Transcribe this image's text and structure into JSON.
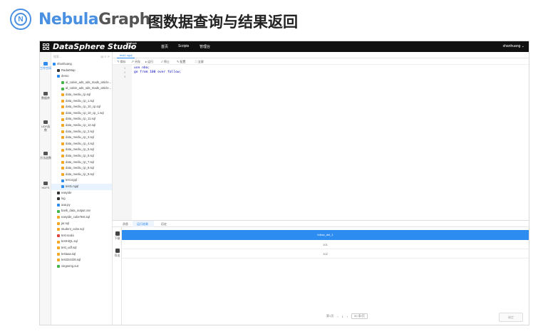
{
  "slide": {
    "brand_part1": "Nebula",
    "brand_part2": "Graph",
    "logo_letter": "N",
    "title": "图数据查询与结果返回"
  },
  "topbar": {
    "app_title": "DataSphere Studio",
    "version_line1": "WeBank",
    "version_line2": "v0.8.7",
    "nav": [
      "首页",
      "Scripts",
      "管理台"
    ],
    "user": "shanhuang"
  },
  "leftnav": [
    {
      "label": "工作空间",
      "icon": "folder-icon",
      "active": true
    },
    {
      "label": "数据库",
      "icon": "database-icon",
      "active": false
    },
    {
      "label": "UDF函数",
      "icon": "function-icon",
      "active": false
    },
    {
      "label": "方法函数",
      "icon": "method-icon",
      "active": false
    },
    {
      "label": "HDFS",
      "icon": "hdfs-icon",
      "active": false
    }
  ],
  "filetree": {
    "search_placeholder": "搜索...",
    "rows": [
      {
        "label": "shanhuang",
        "indent": 0,
        "icon": "folder-icon",
        "color": "#2d8cf0"
      },
      {
        "label": "RadarMap",
        "indent": 1,
        "icon": "folder-icon",
        "color": "#333"
      },
      {
        "label": "demo",
        "indent": 1,
        "icon": "folder-open-icon",
        "color": "#2d8cf0"
      },
      {
        "label": "al_calvin_ads_ods_mads_article...",
        "indent": 2,
        "icon": "file-icon",
        "color": "#44b549"
      },
      {
        "label": "al_calvin_ads_ods_mads_article...",
        "indent": 2,
        "icon": "file-icon",
        "color": "#44b549"
      },
      {
        "label": "data_mediu_cp.sql",
        "indent": 2,
        "icon": "sql-icon",
        "color": "#f5a623"
      },
      {
        "label": "data_mediu_cp_1.sql",
        "indent": 2,
        "icon": "sql-icon",
        "color": "#f5a623"
      },
      {
        "label": "data_mediu_cp_10_cp.sql",
        "indent": 2,
        "icon": "sql-icon",
        "color": "#f5a623"
      },
      {
        "label": "data_mediu_cp_10_cp_1.sql",
        "indent": 2,
        "icon": "sql-icon",
        "color": "#f5a623"
      },
      {
        "label": "data_mediu_cp_11.sql",
        "indent": 2,
        "icon": "sql-icon",
        "color": "#f5a623"
      },
      {
        "label": "data_mediu_cp_12.sql",
        "indent": 2,
        "icon": "sql-icon",
        "color": "#f5a623"
      },
      {
        "label": "data_mediu_cp_2.sql",
        "indent": 2,
        "icon": "sql-icon",
        "color": "#f5a623"
      },
      {
        "label": "data_mediu_cp_3.sql",
        "indent": 2,
        "icon": "sql-icon",
        "color": "#f5a623"
      },
      {
        "label": "data_mediu_cp_4.sql",
        "indent": 2,
        "icon": "sql-icon",
        "color": "#f5a623"
      },
      {
        "label": "data_mediu_cp_5.sql",
        "indent": 2,
        "icon": "sql-icon",
        "color": "#f5a623"
      },
      {
        "label": "data_mediu_cp_6.sql",
        "indent": 2,
        "icon": "sql-icon",
        "color": "#f5a623"
      },
      {
        "label": "data_mediu_cp_7.sql",
        "indent": 2,
        "icon": "sql-icon",
        "color": "#f5a623"
      },
      {
        "label": "data_mediu_cp_8.sql",
        "indent": 2,
        "icon": "sql-icon",
        "color": "#f5a623"
      },
      {
        "label": "data_mediu_cp_9.sql",
        "indent": 2,
        "icon": "sql-icon",
        "color": "#f5a623"
      },
      {
        "label": "test.ngql",
        "indent": 2,
        "icon": "ngql-icon",
        "color": "#2d8cf0"
      },
      {
        "label": "test1.ngql",
        "indent": 2,
        "icon": "ngql-icon",
        "color": "#2d8cf0",
        "selected": true
      },
      {
        "label": "easyide",
        "indent": 1,
        "icon": "folder-icon",
        "color": "#333"
      },
      {
        "label": "log",
        "indent": 1,
        "icon": "folder-icon",
        "color": "#333"
      },
      {
        "label": "aaa.py",
        "indent": 1,
        "icon": "python-icon",
        "color": "#2d8cf0"
      },
      {
        "label": "bank_data_output.csv",
        "indent": 1,
        "icon": "csv-icon",
        "color": "#44b549"
      },
      {
        "label": "easyide_cubeTest.sql",
        "indent": 1,
        "icon": "sql-icon",
        "color": "#f5a623"
      },
      {
        "label": "jar.sql",
        "indent": 1,
        "icon": "sql-icon",
        "color": "#f5a623"
      },
      {
        "label": "student_cube.sql",
        "indent": 1,
        "icon": "sql-icon",
        "color": "#f5a623"
      },
      {
        "label": "test.scala",
        "indent": 1,
        "icon": "scala-icon",
        "color": "#e0443b"
      },
      {
        "label": "testHiQL.sql",
        "indent": 1,
        "icon": "sql-icon",
        "color": "#f5a623"
      },
      {
        "label": "test_udf.sql",
        "indent": 1,
        "icon": "sql-icon",
        "color": "#f5a623"
      },
      {
        "label": "testaaa.sql",
        "indent": 1,
        "icon": "sql-icon",
        "color": "#f5a623"
      },
      {
        "label": "test324426.sql",
        "indent": 1,
        "icon": "sql-icon",
        "color": "#f5a623"
      },
      {
        "label": "vingeeng.out",
        "indent": 1,
        "icon": "out-icon",
        "color": "#44b549"
      }
    ]
  },
  "editor": {
    "tab": "test1.ngql",
    "tools": [
      "保存",
      "另存",
      "运行",
      "停止",
      "配置",
      "全屏"
    ],
    "lines": [
      {
        "num": "1",
        "code": "use nba;"
      },
      {
        "num": "2",
        "code": "go from 100 over follow;"
      },
      {
        "num": "3",
        "code": ""
      }
    ]
  },
  "results": {
    "tabs": [
      "消息",
      "运行结果",
      "历史"
    ],
    "active_tab": 1,
    "side": [
      "下载",
      "导出"
    ],
    "column": "follow_dst_1",
    "rows": [
      "101",
      "102"
    ],
    "pager": {
      "page_label": "第1页",
      "prev": "‹",
      "page": "1",
      "next": "›",
      "page_size": "50 条/页"
    },
    "confirm": "确定"
  }
}
